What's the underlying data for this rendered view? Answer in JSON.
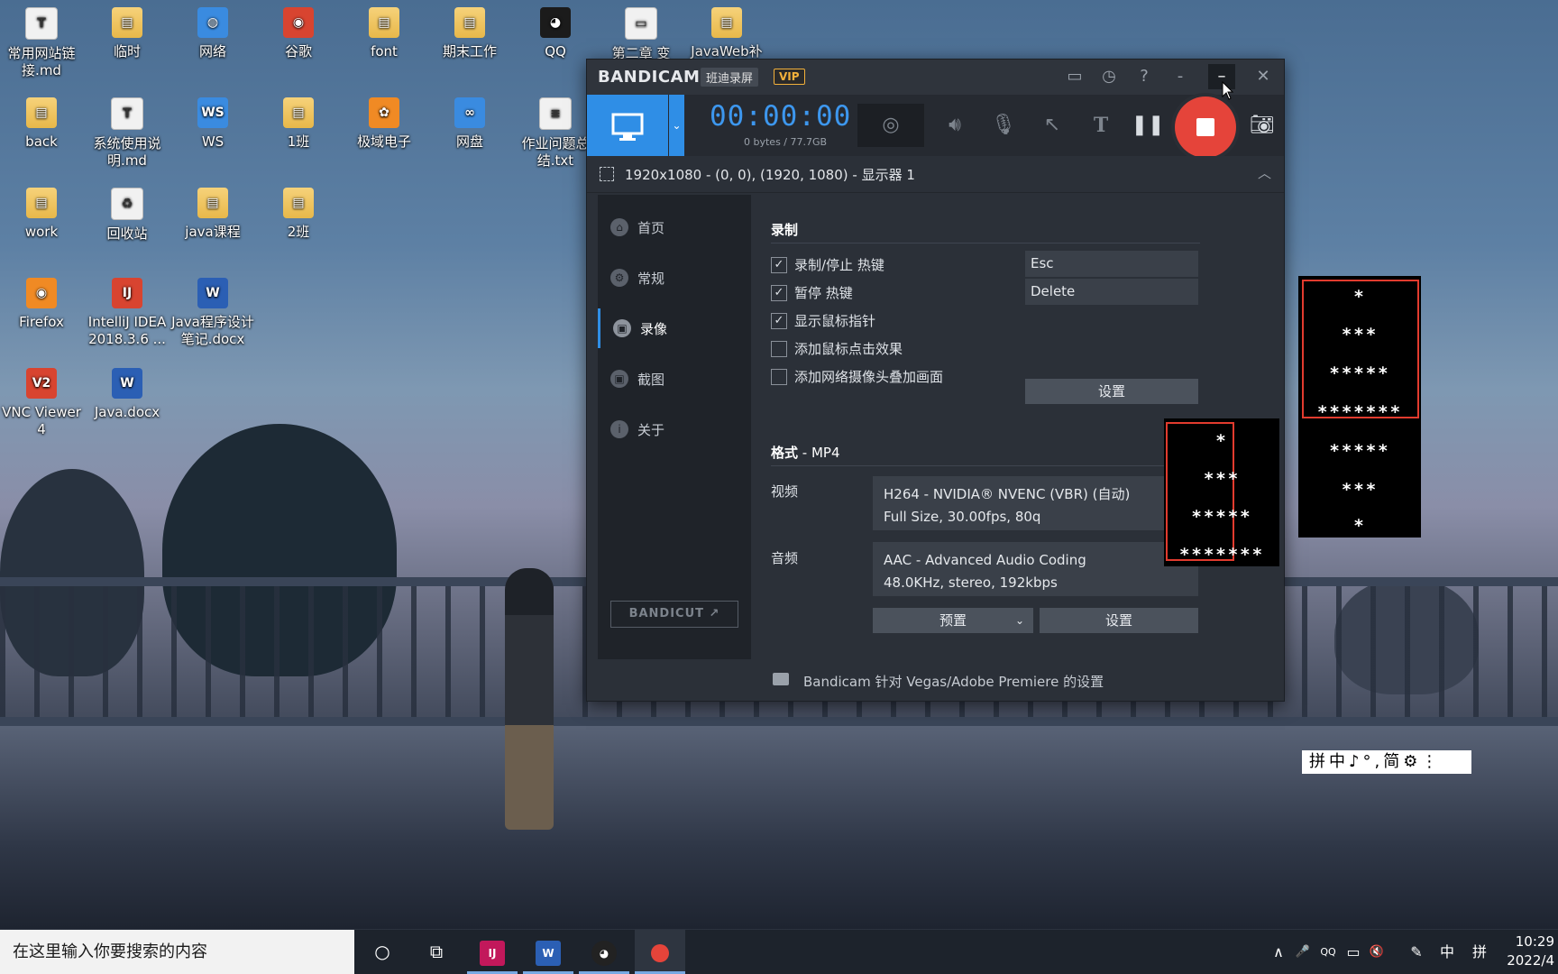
{
  "desktop": {
    "icons": [
      {
        "label": "常用网站链\n接.md",
        "type": "txt",
        "glyph": "T"
      },
      {
        "label": "临时",
        "type": "folder",
        "glyph": "▤"
      },
      {
        "label": "网络",
        "type": "blue",
        "glyph": "◍"
      },
      {
        "label": "谷歌",
        "type": "red",
        "glyph": "◉"
      },
      {
        "label": "font",
        "type": "folder",
        "glyph": "▤"
      },
      {
        "label": "期末工作",
        "type": "folder",
        "glyph": "▤"
      },
      {
        "label": "QQ",
        "type": "qq",
        "glyph": "◕"
      },
      {
        "label": "第二章 变",
        "type": "txt",
        "glyph": "▭"
      },
      {
        "label": "JavaWeb补",
        "type": "folder",
        "glyph": "▤"
      },
      {
        "label": "back",
        "type": "folder",
        "glyph": "▤"
      },
      {
        "label": "系统使用说\n明.md",
        "type": "txt",
        "glyph": "T"
      },
      {
        "label": "WS",
        "type": "blue",
        "glyph": "WS"
      },
      {
        "label": "1班",
        "type": "folder",
        "glyph": "▤"
      },
      {
        "label": "极域电子",
        "type": "orange",
        "glyph": "✿"
      },
      {
        "label": "网盘",
        "type": "blue",
        "glyph": "∞"
      },
      {
        "label": "作业问题总\n结.txt",
        "type": "txt",
        "glyph": "≡"
      },
      {
        "label": "work",
        "type": "folder",
        "glyph": "▤"
      },
      {
        "label": "回收站",
        "type": "txt",
        "glyph": "♻"
      },
      {
        "label": "java课程",
        "type": "folder",
        "glyph": "▤"
      },
      {
        "label": "2班",
        "type": "folder",
        "glyph": "▤"
      },
      {
        "label": "Firefox",
        "type": "orange",
        "glyph": "◉"
      },
      {
        "label": "IntelliJ IDEA\n2018.3.6 ...",
        "type": "red",
        "glyph": "IJ"
      },
      {
        "label": "Java程序设计\n笔记.docx",
        "type": "word",
        "glyph": "W"
      },
      {
        "label": "VNC Viewer\n4",
        "type": "red",
        "glyph": "V2"
      },
      {
        "label": "Java.docx",
        "type": "word",
        "glyph": "W"
      }
    ]
  },
  "bandicam": {
    "logo": "BANDICAM",
    "sub_label": "班迪录屏",
    "vip_label": "VIP",
    "title_icons": [
      "folder-icon",
      "clock-icon",
      "help-icon",
      "settings-dash-icon",
      "minimize-icon",
      "close-icon"
    ],
    "timer": "00:00:00",
    "bytes": "0 bytes / 77.7GB",
    "area_text": "1920x1080 - (0, 0), (1920, 1080) - 显示器 1",
    "sidebar": [
      {
        "label": "首页",
        "icon": "⌂"
      },
      {
        "label": "常规",
        "icon": "⚙"
      },
      {
        "label": "录像",
        "icon": "▣"
      },
      {
        "label": "截图",
        "icon": "▣"
      },
      {
        "label": "关于",
        "icon": "i"
      }
    ],
    "bandicut_label": "BANDICUT ↗",
    "record_section": {
      "title": "录制",
      "options": [
        {
          "label": "录制/停止 热键",
          "checked": true
        },
        {
          "label": "暂停 热键",
          "checked": true
        },
        {
          "label": "显示鼠标指针",
          "checked": true
        },
        {
          "label": "添加鼠标点击效果",
          "checked": false
        },
        {
          "label": "添加网络摄像头叠加画面",
          "checked": false
        }
      ],
      "hotkey_record": "Esc",
      "hotkey_pause": "Delete",
      "settings_label": "设置"
    },
    "format_section": {
      "title": "格式",
      "format_value": " - MP4",
      "video_label": "视频",
      "video_line1": "H264 - NVIDIA® NVENC (VBR) (自动)",
      "video_line2": "Full Size, 30.00fps, 80q",
      "audio_label": "音频",
      "audio_line1": "AAC - Advanced Audio Coding",
      "audio_line2": "48.0KHz, stereo, 192kbps",
      "preset_label": "预置",
      "settings_label": "设置"
    },
    "footer_text": "Bandicam 针对 Vegas/Adobe Premiere 的设置"
  },
  "star_window_1": [
    "*",
    "***",
    "*****",
    "*******"
  ],
  "star_window_2": [
    "*",
    "***",
    "*****",
    "*******",
    "*****",
    "***",
    "*"
  ],
  "ime_bar": "拼中♪°,简⚙⋮",
  "taskbar": {
    "search_placeholder": "在这里输入你要搜索的内容",
    "tray_items": [
      "∧",
      "🎤",
      "QQ",
      "▭",
      "🔇",
      "✎",
      "中",
      "拼"
    ],
    "clock_time": "10:29",
    "clock_date": "2022/4"
  }
}
